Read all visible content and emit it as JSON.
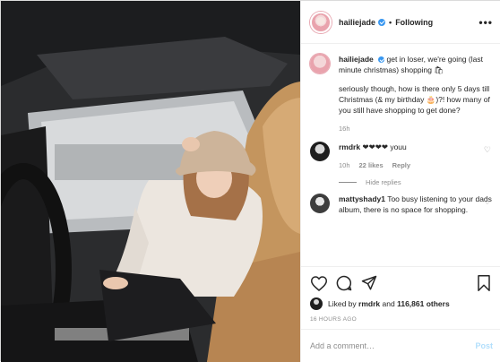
{
  "post": {
    "username": "hailiejade",
    "following_label": "Following",
    "more_label": "•••"
  },
  "caption": {
    "username": "hailiejade",
    "line1": "get in loser, we're going (last minute christmas) shopping 🛍",
    "line2": "seriously though, how is there only 5 days till Christmas (& my birthday 🎂)?! how many of you still have shopping to get done?",
    "time": "16h"
  },
  "comments": [
    {
      "username": "rmdrk",
      "text": "❤❤❤❤ youu",
      "time": "10h",
      "likes": "22 likes",
      "reply": "Reply"
    },
    {
      "username": "mattyshady1",
      "text": "Too busy listening to your dads album, there is no space for shopping."
    }
  ],
  "hide_replies": "Hide replies",
  "likes": {
    "prefix": "Liked by",
    "user": "rmdrk",
    "and": "and",
    "count": "116,861 others"
  },
  "timestamp": "16 HOURS AGO",
  "add_comment": {
    "placeholder": "Add a comment…",
    "post_label": "Post"
  },
  "icons": {
    "like": "heart-icon",
    "comment": "comment-icon",
    "share": "share-icon",
    "save": "bookmark-icon"
  },
  "colors": {
    "verified": "#3897f0",
    "text": "#262626",
    "muted": "#8e8e8e",
    "post_disabled": "#b2dffc"
  }
}
